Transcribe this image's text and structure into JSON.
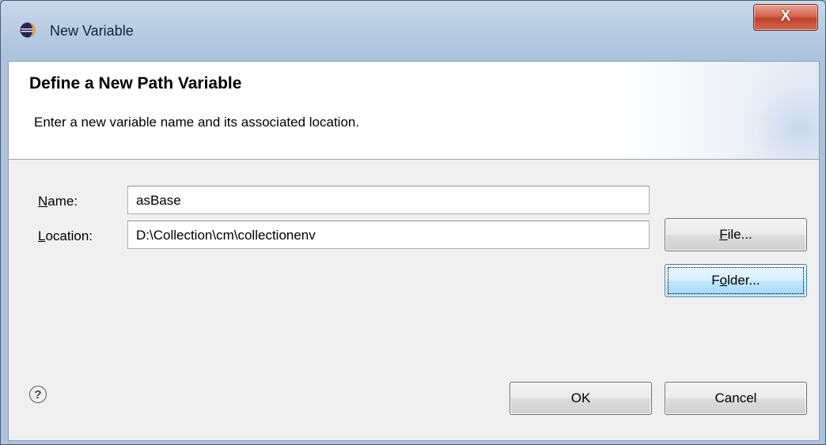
{
  "window": {
    "title": "New Variable",
    "close_label": "X"
  },
  "header": {
    "title": "Define a New Path Variable",
    "description": "Enter a new variable name and its associated location."
  },
  "form": {
    "name_label_mnemonic": "N",
    "name_label_rest": "ame:",
    "name_value": "asBase",
    "location_label_mnemonic": "L",
    "location_label_rest": "ocation:",
    "location_value": "D:\\Collection\\cm\\collectionenv"
  },
  "buttons": {
    "file_mnemonic": "F",
    "file_rest": "ile...",
    "folder_prefix": "F",
    "folder_mnemonic": "o",
    "folder_rest": "lder...",
    "ok": "OK",
    "cancel": "Cancel",
    "help": "?"
  },
  "icons": {
    "app": "eclipse-icon",
    "help": "help-circle-icon"
  }
}
